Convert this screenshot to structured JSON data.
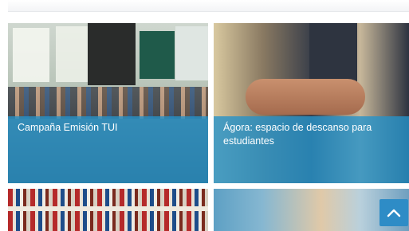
{
  "cards": [
    {
      "title": "Campaña Emisión TUI"
    },
    {
      "title": "Ágora: espacio de descanso para estudiantes"
    },
    {
      "title": ""
    },
    {
      "title": ""
    }
  ],
  "scroll_top": {
    "icon": "chevron-up-icon"
  },
  "colors": {
    "caption_overlay": "#2692c9",
    "scroll_button": "#2e8cc6"
  }
}
